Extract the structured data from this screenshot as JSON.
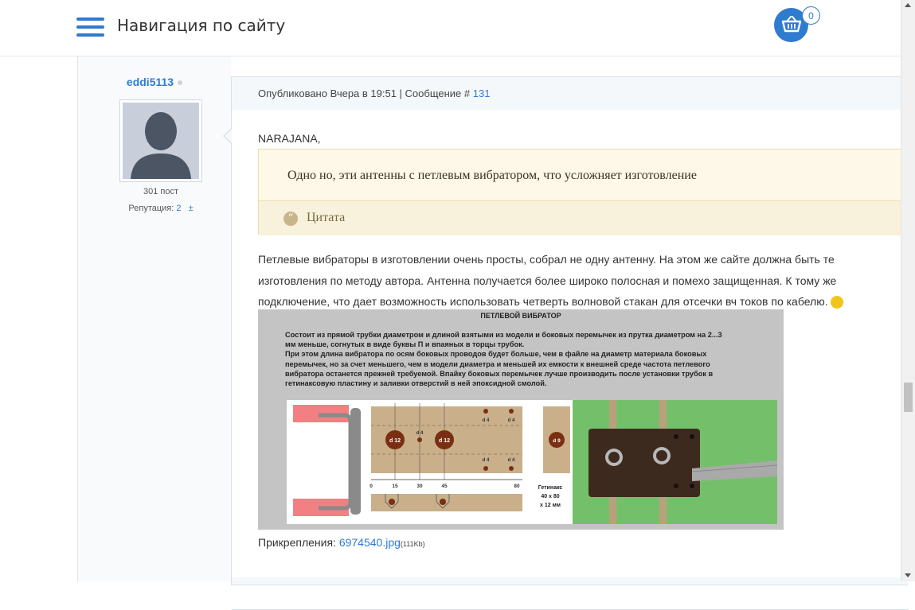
{
  "header": {
    "nav_title": "Навигация по сайту",
    "cart_count": "0",
    "menu_icon": "hamburger-menu-icon",
    "cart_icon": "basket-icon",
    "accent_color": "#2f7bcf"
  },
  "author": {
    "name": "eddi5113",
    "posts": "301 пост",
    "reputation_label": "Репутация:",
    "reputation_value": "2",
    "reputation_control": "±",
    "avatar_icon": "default-avatar-silhouette-icon"
  },
  "post": {
    "meta_prefix": "Опубликовано Вчера в 19:51 | Сообщение #",
    "message_number": "131",
    "mention": "NARAJANA,",
    "quote_text": "Одно но, эти антенны с петлевым вибратором, что усложняет изготовление",
    "quote_label": "Цитата",
    "quote_icon": "quote-marks-icon",
    "body_lines": [
      "Петлевые вибраторы в изготовлении очень просты, собрал не одну антенну. На этом же сайте должна быть те",
      "изготовления по методу автора. Антенна получается более широко полосная и помехо защищенная. К тому же",
      "подключение, что дает возможность использовать четверть волновой стакан для отсечки вч токов по кабелю."
    ],
    "smiley_icon": "smiley-icon",
    "attachments_label": "Прикрепления:",
    "attachment_file": "6974540.jpg",
    "attachment_size": "(111Kb)"
  },
  "attachment_image": {
    "title": "ПЕТЛЕВОЙ ВИБРАТОР",
    "text_lines": [
      "Состоит из прямой трубки диаметром и длиной взятыми из модели и боковых перемычек из прутка диаметром на 2...3",
      "мм меньше, согнутых в виде буквы П и впаяных в торцы трубок.",
      "При этом длина вибратора по осям боковых проводов будет больше, чем в файле на диаметр материала боковых",
      "перемычек, но за счет меньшего, чем в модели диаметра и меньшей их емкости к внешней среде частота петлевого",
      "вибратора останется прежней требуемой. Впайку боковых перемычек лучше производить после установки трубок в",
      "гетинаксовую пластину и заливки отверстий в ней эпоксидной смолой."
    ],
    "hole_large": "d 12",
    "hole_small": "d 4",
    "hole_side": "d 9",
    "axis_ticks": [
      "0",
      "15",
      "30",
      "45",
      "80"
    ],
    "material_lines": [
      "Гетинакс",
      "40 x 80",
      "x 12 мм"
    ]
  }
}
